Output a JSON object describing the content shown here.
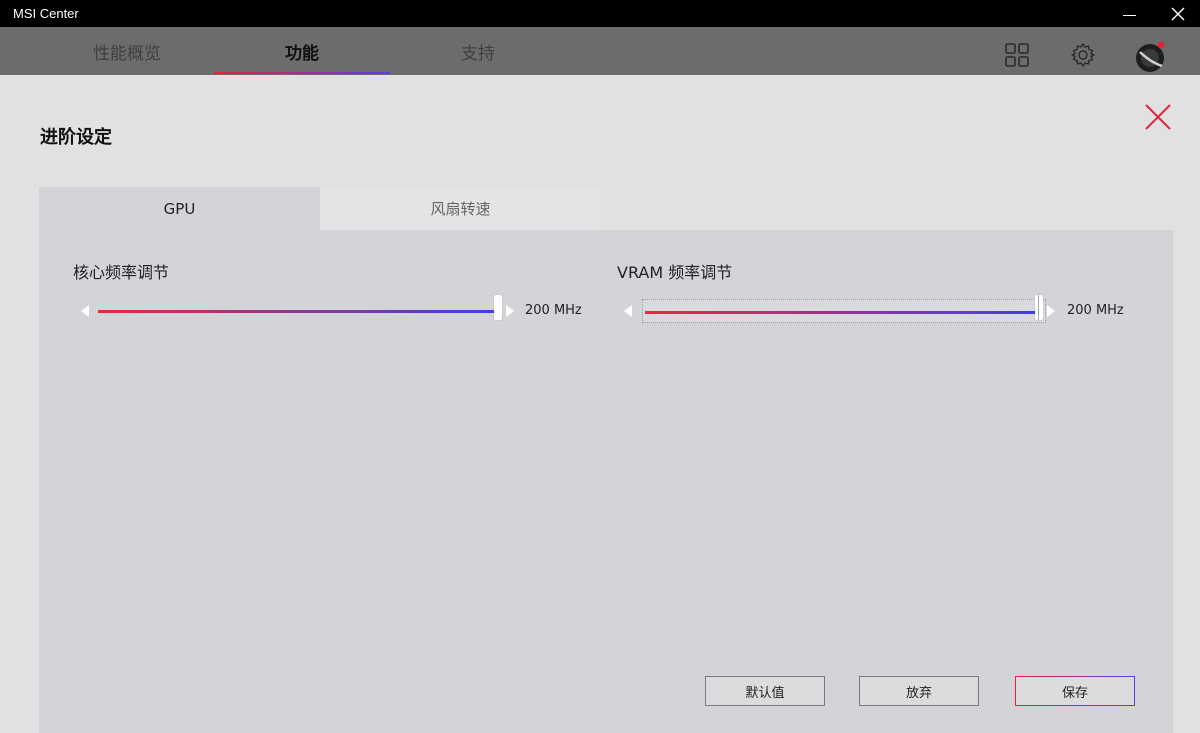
{
  "window": {
    "title": "MSI Center"
  },
  "nav": {
    "tabs": [
      {
        "label": "性能概览"
      },
      {
        "label": "功能"
      },
      {
        "label": "支持"
      }
    ],
    "active_tab": "功能",
    "icons": [
      "grid-icon",
      "gear-icon",
      "profile-icon"
    ]
  },
  "panel": {
    "title": "进阶设定",
    "tabs": [
      {
        "label": "GPU"
      },
      {
        "label": "风扇转速"
      }
    ],
    "active_tab": "GPU",
    "sliders": [
      {
        "label": "核心频率调节",
        "value": "200 MHz",
        "level": 1.0
      },
      {
        "label": "VRAM 频率调节",
        "value": "200 MHz",
        "level": 1.0
      }
    ],
    "buttons": {
      "default": "默认值",
      "discard": "放弃",
      "save": "保存"
    }
  },
  "colors": {
    "accent_red": "#e0243b",
    "accent_blue": "#5a3be6",
    "close_red": "#e0243b"
  }
}
